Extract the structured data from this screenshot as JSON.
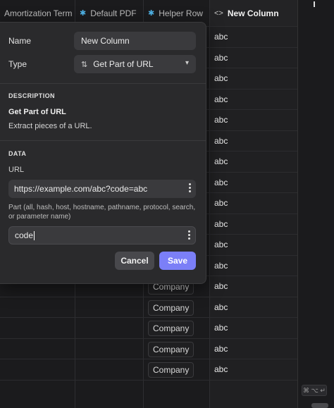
{
  "grid": {
    "columns": [
      {
        "key": "amort",
        "label": "Amortization Term",
        "icon": ""
      },
      {
        "key": "pdf",
        "label": "Default PDF",
        "icon": "sparkle-icon"
      },
      {
        "key": "helper",
        "label": "Helper Row",
        "icon": "sparkle-icon"
      },
      {
        "key": "new",
        "label": "New Column",
        "icon": "code-icon"
      }
    ],
    "new_column_values": [
      "abc",
      "abc",
      "abc",
      "abc",
      "abc",
      "abc",
      "abc",
      "abc",
      "abc",
      "abc",
      "abc",
      "abc",
      "abc",
      "abc",
      "abc",
      "abc",
      "abc"
    ],
    "helper_values": [
      "Company",
      "Company",
      "Company",
      "Company",
      "Company"
    ]
  },
  "popup": {
    "name_label": "Name",
    "name_value": "New Column",
    "type_label": "Type",
    "type_value": "Get Part of URL",
    "description_header": "DESCRIPTION",
    "description_title": "Get Part of URL",
    "description_text": "Extract pieces of a URL.",
    "data_header": "DATA",
    "url_label": "URL",
    "url_value": "https://example.com/abc?code=abc",
    "part_label": "Part (all, hash, host, hostname, pathname, protocol, search, or parameter name)",
    "part_value": "code",
    "cancel_label": "Cancel",
    "save_label": "Save"
  },
  "shortcut_hint": "⌘ ⌥ ↵",
  "colors": {
    "accent": "#7b7ff7",
    "background": "#1b1b1d",
    "popup": "#2a2a2c"
  }
}
